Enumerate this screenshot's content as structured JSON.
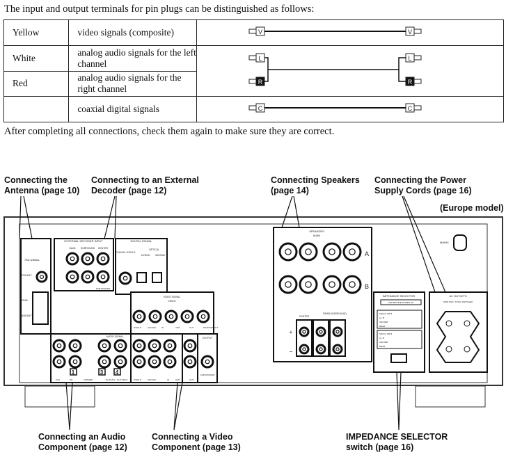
{
  "intro": "The input and output terminals for pin plugs can be distinguished as follows:",
  "table": {
    "rows": [
      {
        "color": "Yellow",
        "signal": "video signals (composite)",
        "plug": "V"
      },
      {
        "color": "White",
        "signal": "analog audio signals for the left channel",
        "plug": "L"
      },
      {
        "color": "Red",
        "signal": "analog audio signals for the right channel",
        "plug": "R"
      },
      {
        "color": "",
        "signal": "coaxial digital signals",
        "plug": "C"
      }
    ]
  },
  "outro": "After completing all connections, check them again to make sure they are correct.",
  "callouts": {
    "antenna": "Connecting the\nAntenna (page 10)",
    "decoder": "Connecting to an External\nDecoder (page 12)",
    "speakers": "Connecting Speakers\n(page 14)",
    "power": "Connecting the Power\nSupply Cords (page 16)",
    "model": "(Europe model)",
    "audio": "Connecting an Audio\nComponent (page 12)",
    "video": "Connecting a Video\nComponent (page 13)",
    "impedance": "IMPEDANCE SELECTOR\nswitch (page 16)"
  },
  "panel": {
    "antenna": [
      "75Ω UNBAL.",
      "FM ANT",
      "GND",
      "AM ANT"
    ],
    "decoder": {
      "title": "EXTERNAL DECODER INPUT",
      "cols": [
        "MAIN",
        "SURROUND",
        "CENTER"
      ],
      "sub": "SUB WOOFER"
    },
    "digital": {
      "title": "DIGITAL SIGNAL",
      "coax": "COAXIAL DVD/LD",
      "optical": "OPTICAL",
      "opt1": "DVD/LD",
      "opt2": "SAT/DAV"
    },
    "video_signal": {
      "title": "VIDEO SIGNAL",
      "sub": "VIDEO",
      "labels": [
        "DVD/LD",
        "SAT/DAV",
        "IN",
        "VCR",
        "OUT",
        "MONITOR OUT"
      ]
    },
    "audio_signal": {
      "title": "AUDIO SIGNAL",
      "labels": [
        "AUX",
        "CD",
        "TAPE/MD",
        "IN (PLAY)",
        "OUT (REC)",
        "DVD/LD",
        "SAT/DAV",
        "IN",
        "VCR",
        "OUT"
      ],
      "nums": [
        "1",
        "3",
        "4"
      ]
    },
    "output": {
      "title": "OUTPUT",
      "sub": "SUB WOOFER"
    },
    "speakers": {
      "title": "SPEAKERS",
      "main": "MAIN",
      "a": "A",
      "b": "B",
      "center": "CENTER",
      "rear": "REAR (SURROUND)"
    },
    "impedance": {
      "title": "IMPEDANCE SELECTOR",
      "note": "SET BEFORE POWER ON",
      "rows": [
        "MAIN A OR B",
        "A + B",
        "CENTER",
        "REAR"
      ]
    },
    "ac": {
      "title": "AC OUTLETS",
      "note": "100W MAX. TOTAL SWITCHED"
    },
    "mains": "MAINS"
  }
}
